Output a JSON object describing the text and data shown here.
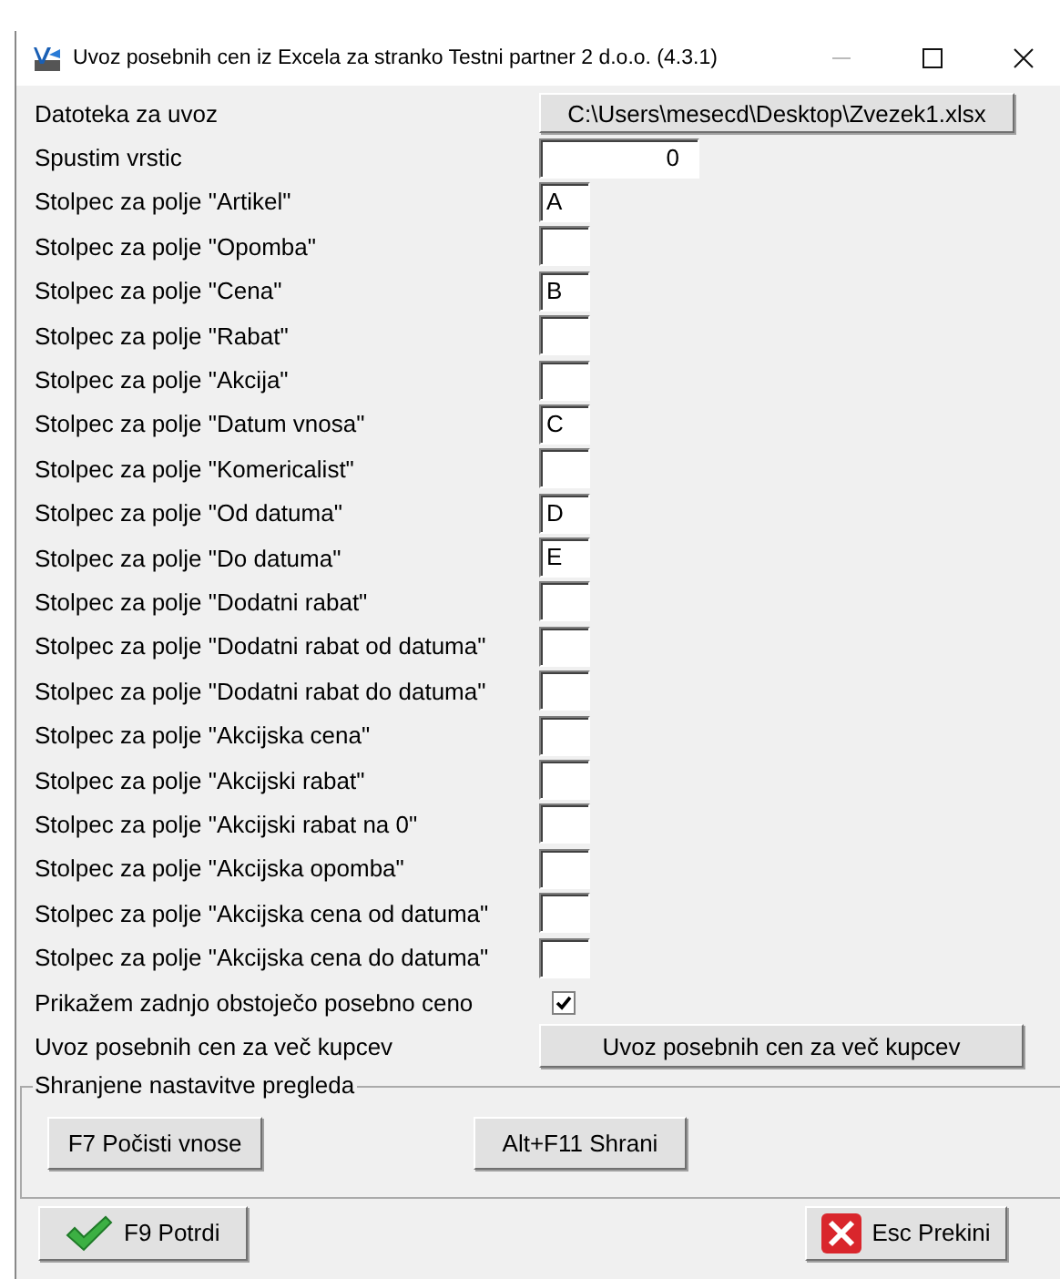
{
  "window": {
    "title": "Uvoz posebnih cen iz Excela za stranko Testni partner 2 d.o.o.  (4.3.1)"
  },
  "file": {
    "label": "Datoteka za uvoz",
    "value": "C:\\Users\\mesecd\\Desktop\\Zvezek1.xlsx"
  },
  "skip": {
    "label": "Spustim vrstic",
    "value": "0"
  },
  "columns": [
    {
      "label": "Stolpec za polje \"Artikel\"",
      "value": "A"
    },
    {
      "label": "Stolpec za polje \"Opomba\""
    },
    {
      "label": "Stolpec za polje \"Cena\"",
      "value": "B"
    },
    {
      "label": "Stolpec za polje \"Rabat\""
    },
    {
      "label": "Stolpec za polje \"Akcija\""
    },
    {
      "label": "Stolpec za polje \"Datum vnosa\"",
      "value": "C"
    },
    {
      "label": "Stolpec za polje \"Komericalist\""
    },
    {
      "label": "Stolpec za polje \"Od datuma\"",
      "value": "D"
    },
    {
      "label": "Stolpec za polje \"Do datuma\"",
      "value": "E"
    },
    {
      "label": "Stolpec za polje \"Dodatni rabat\""
    },
    {
      "label": "Stolpec za polje \"Dodatni rabat od datuma\""
    },
    {
      "label": "Stolpec za polje \"Dodatni rabat do datuma\""
    },
    {
      "label": "Stolpec za polje \"Akcijska cena\""
    },
    {
      "label": "Stolpec za polje \"Akcijski rabat\""
    },
    {
      "label": "Stolpec za polje \"Akcijski rabat na 0\""
    },
    {
      "label": "Stolpec za polje \"Akcijska opomba\""
    },
    {
      "label": "Stolpec za polje \"Akcijska cena od datuma\""
    },
    {
      "label": "Stolpec za polje \"Akcijska cena do datuma\""
    }
  ],
  "show_last": {
    "label": "Prikažem zadnjo obstoječo posebno ceno",
    "checked": true
  },
  "multi": {
    "label": "Uvoz posebnih cen za več kupcev",
    "button": "Uvoz posebnih cen za več kupcev"
  },
  "saved": {
    "title": "Shranjene nastavitve pregleda",
    "buttons": [
      "F7 Počisti vnose",
      "Alt+F11 Shrani"
    ]
  },
  "footer": {
    "confirm": "F9 Potrdi",
    "cancel": "Esc Prekini"
  }
}
